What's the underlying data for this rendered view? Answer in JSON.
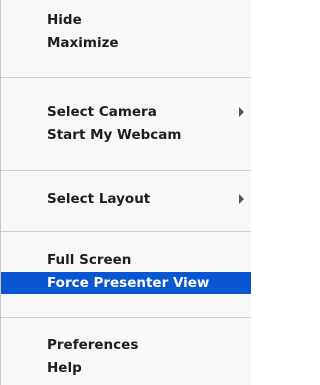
{
  "menu": {
    "items": [
      {
        "label": "Hide"
      },
      {
        "label": "Maximize"
      },
      {
        "label": "Select Camera",
        "icon": "chevron-right-icon"
      },
      {
        "label": "Start My Webcam"
      },
      {
        "label": "Select Layout",
        "icon": "chevron-right-icon"
      },
      {
        "label": "Full Screen"
      },
      {
        "label": "Force Presenter View",
        "selected": true
      },
      {
        "label": "Preferences"
      },
      {
        "label": "Help"
      }
    ],
    "selected_color": "#0a55d2"
  }
}
